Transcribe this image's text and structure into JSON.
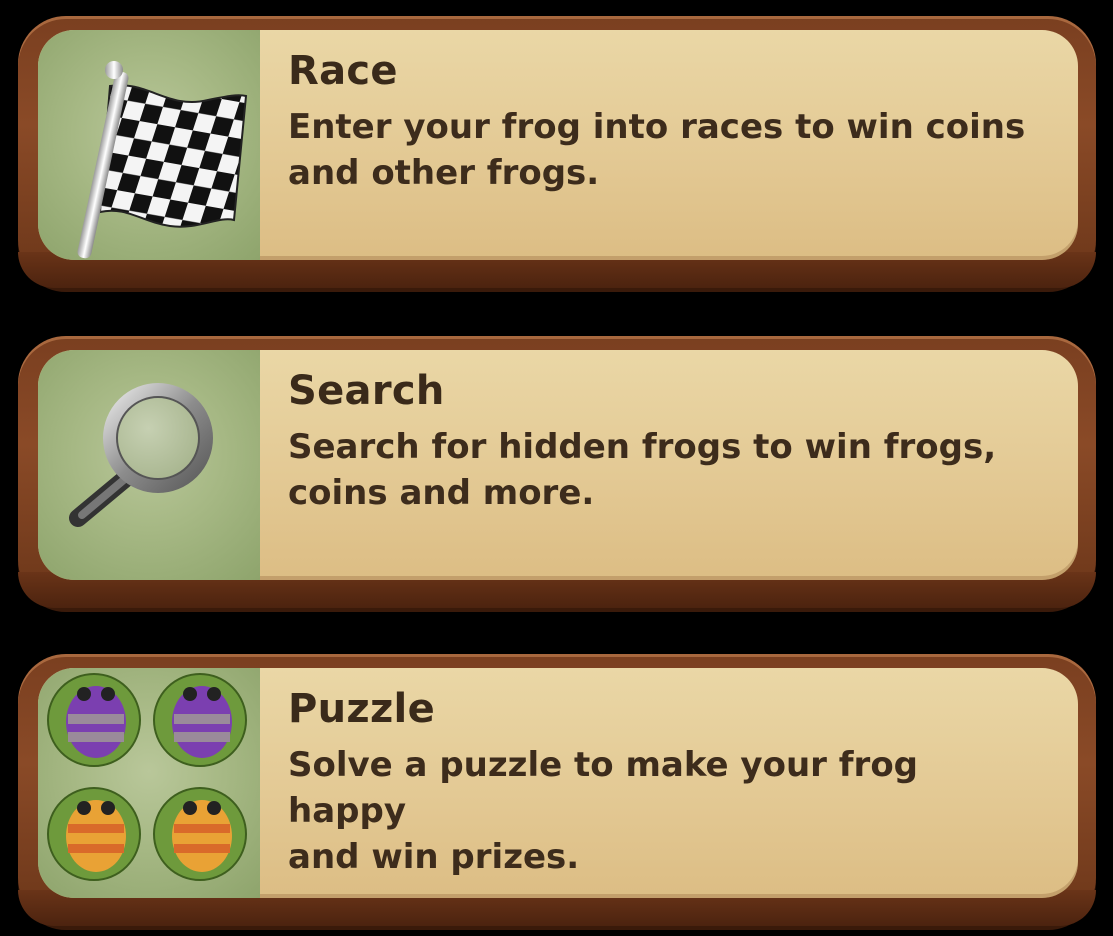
{
  "menu": {
    "items": [
      {
        "title": "Race",
        "description_line1": "Enter your frog into races to win coins",
        "description_line2": "and other frogs.",
        "icon": "checkered-flag-icon"
      },
      {
        "title": "Search",
        "description_line1": "Search for hidden frogs to win frogs,",
        "description_line2": "coins and more.",
        "icon": "magnifying-glass-icon"
      },
      {
        "title": "Puzzle",
        "description_line1": "Solve a puzzle to make your frog happy",
        "description_line2": "and win prizes.",
        "icon": "frog-puzzle-icon"
      }
    ]
  },
  "colors": {
    "frame": "#7a3f20",
    "panel": "#e3c994",
    "icon_bg": "#a6b884",
    "text": "#3a2a1a"
  }
}
